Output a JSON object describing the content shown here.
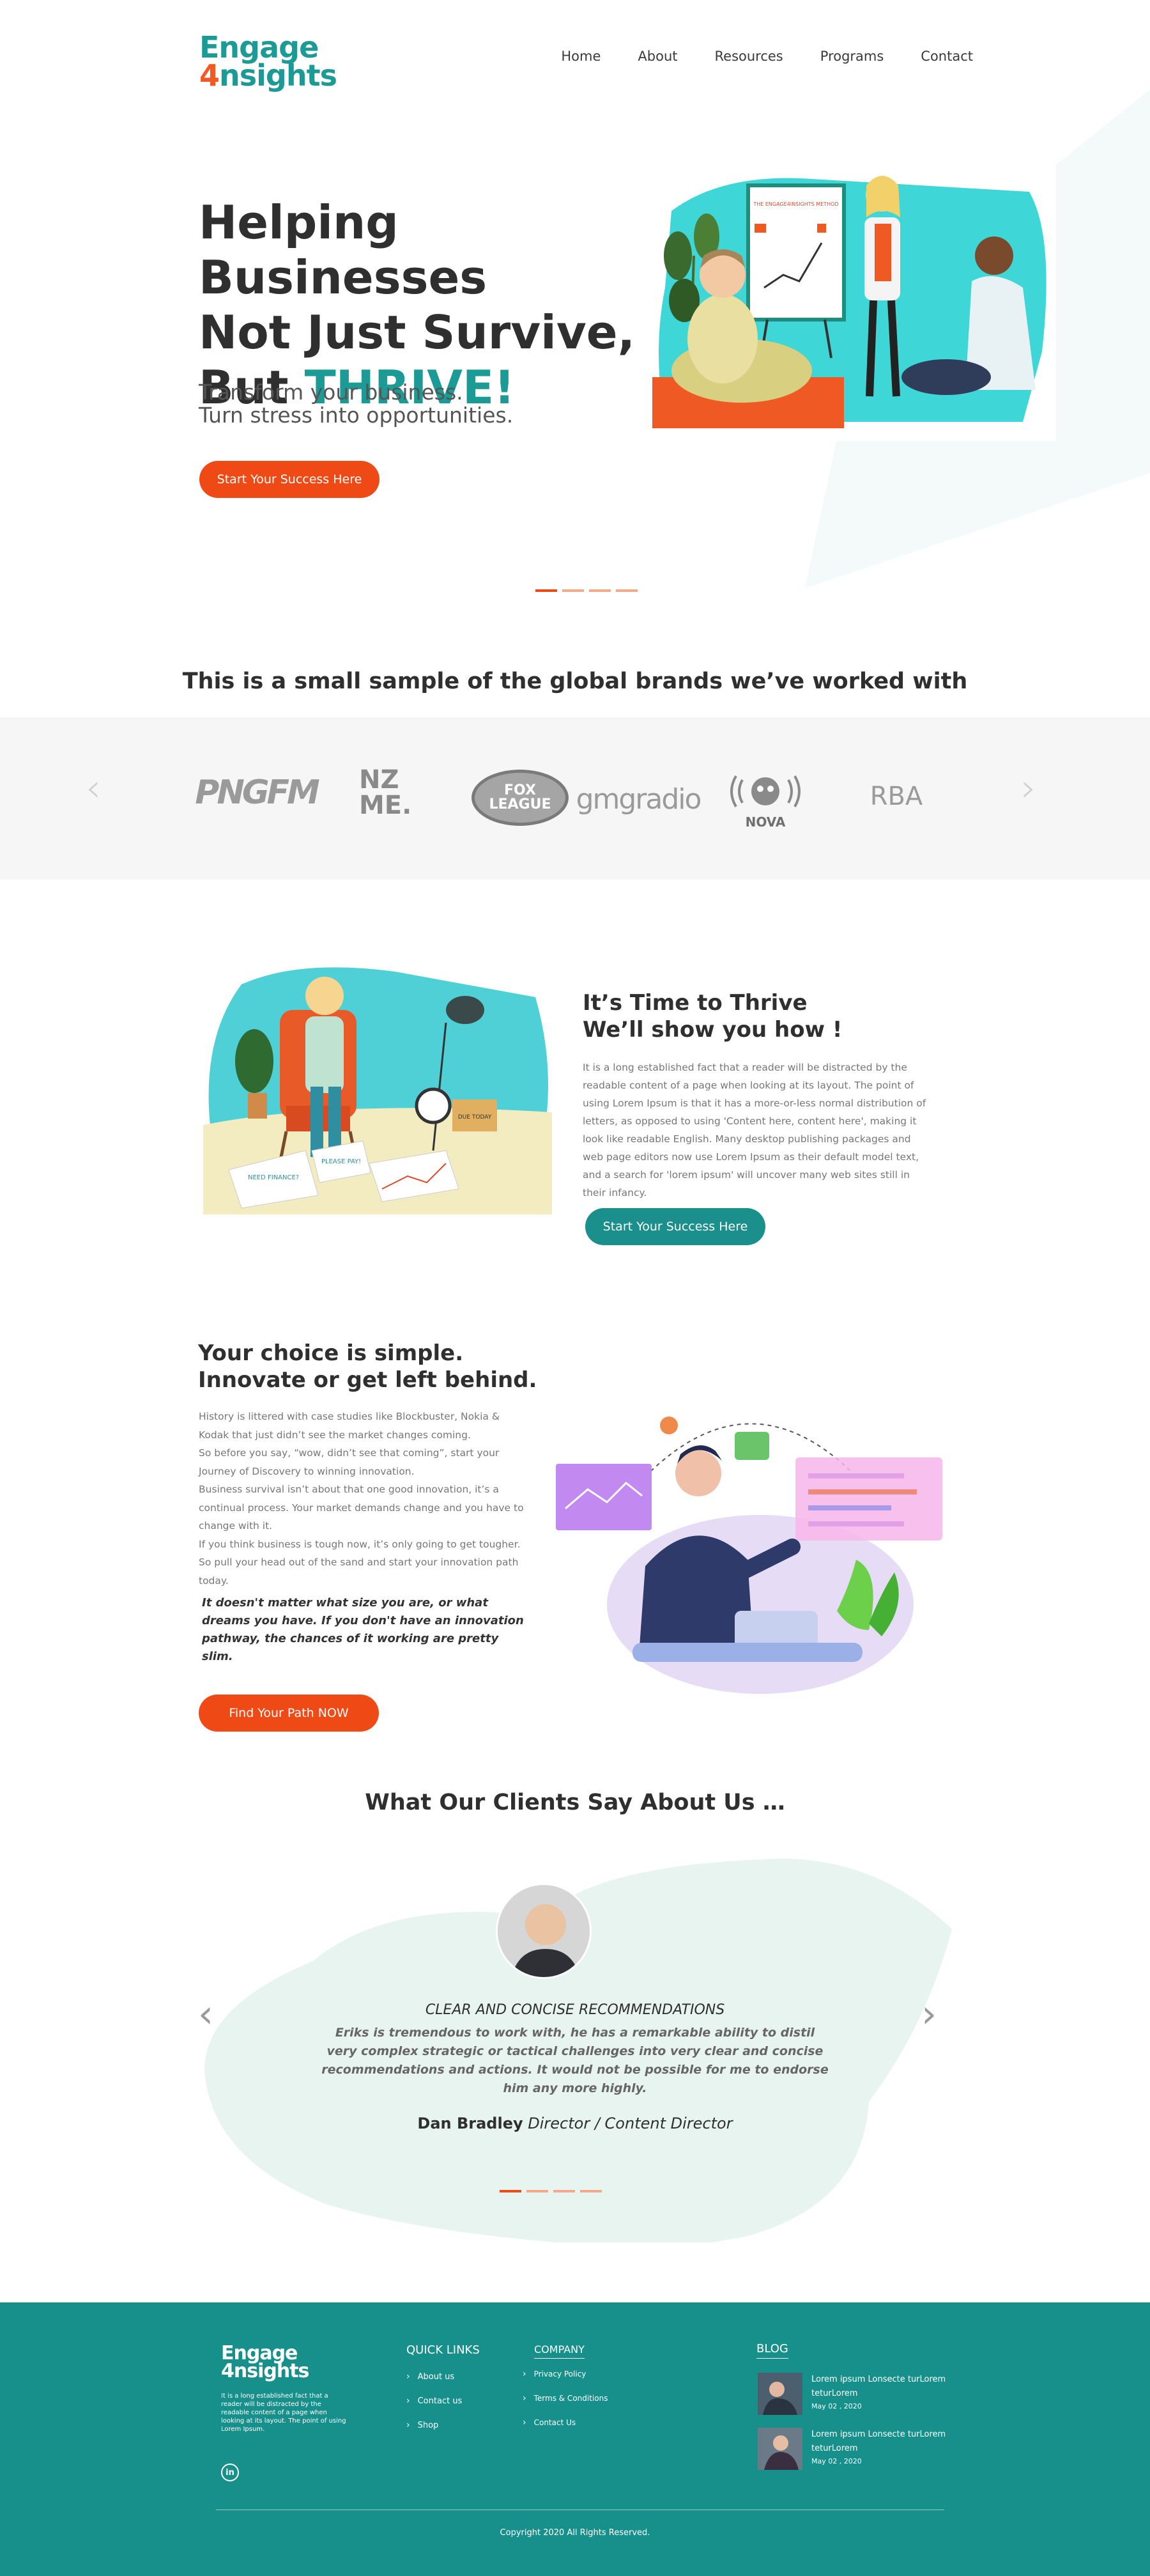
{
  "header": {
    "logo_line1": "Engage",
    "logo_four": "4",
    "logo_line2": "nsights",
    "nav": [
      "Home",
      "About",
      "Resources",
      "Programs",
      "Contact"
    ]
  },
  "hero": {
    "title_line1": "Helping Businesses",
    "title_line2": "Not Just Survive,",
    "title_but": "But ",
    "title_thrive": "THRIVE!",
    "subtitle_line1": "Transform your business.",
    "subtitle_line2": "Turn stress into opportunities.",
    "cta": "Start Your Success Here",
    "board_text": "THE ENGAGE4INSIGHTS METHOD"
  },
  "brands": {
    "title": "This is a small sample of the global brands we’ve worked with",
    "items": [
      "PNGFM",
      "NZ ME.",
      "FOX LEAGUE",
      "gmgradio",
      "NOVA",
      "RBA"
    ]
  },
  "thrive": {
    "title_line1": "It’s Time to Thrive",
    "title_line2": "We’ll show you how !",
    "body": "It is a long established fact that a reader will be distracted by the readable content of a page when looking at its layout. The point of using Lorem Ipsum is that it has a more-or-less normal distribution of letters, as opposed to using 'Content here, content here', making it look like readable English. Many desktop publishing packages and web page editors now use Lorem Ipsum as their default model text, and a search for 'lorem ipsum' will uncover many web sites still in their infancy.",
    "cta": "Start Your Success Here",
    "note1": "NEED FINANCE?",
    "note2": "PLEASE PAY!",
    "box_label": "DUE TODAY"
  },
  "choice": {
    "title_line1": "Your choice is simple.",
    "title_line2": "Innovate or get left behind.",
    "body": [
      "History is littered with case studies like Blockbuster, Nokia & Kodak that just didn’t see the market changes coming.",
      "So before you say, “wow, didn’t see that coming”, start your Journey of Discovery to winning innovation.",
      "Business survival isn’t about that one good innovation, it’s a continual process.  Your market demands change and you have to change with it.",
      "If you think business is tough now, it’s only going to get tougher.",
      "So pull your head out of the sand and start your innovation path today."
    ],
    "italic": "It doesn't matter what size you are, or what dreams you have. If you don't have an innovation pathway, the chances of it working are pretty slim.",
    "cta": "Find Your Path NOW"
  },
  "testimonials": {
    "title": "What Our Clients Say About Us …",
    "heading": "CLEAR AND CONCISE RECOMMENDATIONS",
    "body": "Eriks is tremendous to work with, he has a remarkable ability to distil very complex strategic or tactical challenges into very clear and concise recommendations and actions. It would not be possible for me to endorse him any more highly.",
    "name": "Dan Bradley",
    "role": " Director / Content Director"
  },
  "footer": {
    "logo_line1": "Engage",
    "logo_four": "4",
    "logo_line2": "nsights",
    "about": "It is a long established fact that a reader will be distracted by the readable content of a page when looking at its layout. The point of using Lorem Ipsum.",
    "linkedin": "in",
    "quick_links_title": "QUICK LINKS",
    "quick_links": [
      "About us",
      "Contact  us",
      "Shop"
    ],
    "company_title": "COMPANY",
    "company_links": [
      "Privacy Policy",
      "Terms & Conditions",
      "Contact Us"
    ],
    "blog_title": "BLOG",
    "blog": [
      {
        "title": "Lorem ipsum Lonsecte turLorem teturLorem",
        "date": "May 02 , 2020"
      },
      {
        "title": "Lorem ipsum Lonsecte turLorem teturLorem",
        "date": "May 02 , 2020"
      }
    ],
    "copyright": "Copyright 2020 All Rights Reserved."
  },
  "colors": {
    "teal": "#1c9a95",
    "orange": "#ef4a15",
    "footer_bg": "#17908c",
    "band_bg": "#f6f6f6",
    "blob": "#e8f4f0"
  }
}
